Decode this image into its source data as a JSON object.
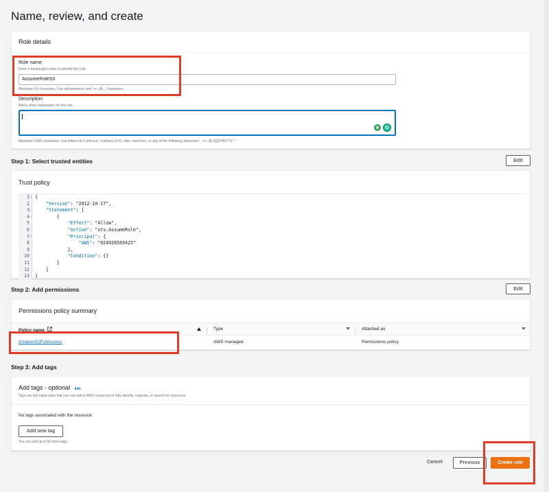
{
  "page": {
    "title": "Name, review, and create"
  },
  "role_details": {
    "heading": "Role details",
    "role_name_label": "Role name",
    "role_name_hint": "Enter a meaningful name to identify this role.",
    "role_name_value": "AssumeRoleS3",
    "role_name_constraint": "Maximum 64 characters. Use alphanumeric and '+=,.@-_' characters.",
    "description_label": "Description",
    "description_hint": "Add a short explanation for this role.",
    "description_value": "",
    "description_constraint": "Maximum 1000 characters. Use letters (A-Z and a-z), numbers (0-9), tabs, new lines, or any of the following characters: _+=,.@-/\\[{}]!#$%^*();\":'`"
  },
  "step1": {
    "title": "Step 1: Select trusted entities",
    "edit_label": "Edit",
    "trust_policy_heading": "Trust policy",
    "code_lines": [
      {
        "n": "1",
        "fold": "-",
        "text": "{"
      },
      {
        "n": "2",
        "fold": "",
        "text": "    \"Version\": \"2012-10-17\","
      },
      {
        "n": "3",
        "fold": "-",
        "text": "    \"Statement\": ["
      },
      {
        "n": "4",
        "fold": "-",
        "text": "        {"
      },
      {
        "n": "5",
        "fold": "",
        "text": "            \"Effect\": \"Allow\","
      },
      {
        "n": "6",
        "fold": "",
        "text": "            \"Action\": \"sts:AssumeRole\","
      },
      {
        "n": "7",
        "fold": "-",
        "text": "            \"Principal\": {"
      },
      {
        "n": "8",
        "fold": "",
        "text": "                \"AWS\": \"024928569425\""
      },
      {
        "n": "9",
        "fold": "",
        "text": "            },"
      },
      {
        "n": "10",
        "fold": "",
        "text": "            \"Condition\": {}"
      },
      {
        "n": "11",
        "fold": "",
        "text": "        }"
      },
      {
        "n": "12",
        "fold": "",
        "text": "    ]"
      },
      {
        "n": "13",
        "fold": "",
        "text": "}"
      }
    ]
  },
  "step2": {
    "title": "Step 2: Add permissions",
    "edit_label": "Edit",
    "summary_heading": "Permissions policy summary",
    "columns": [
      "Policy name",
      "Type",
      "Attached as"
    ],
    "rows": [
      {
        "policy_name": "AmazonS3FullAccess",
        "type": "AWS managed",
        "attached_as": "Permissions policy"
      }
    ]
  },
  "step3": {
    "title": "Step 3: Add tags",
    "heading": "Add tags - ",
    "heading_optional": "optional",
    "info_label": "Info",
    "hint": "Tags are key-value pairs that you can add to AWS resources to help identify, organize, or search for resources.",
    "empty_text": "No tags associated with the resource.",
    "add_tag_label": "Add new tag",
    "limit_text": "You can add up to 50 more tags."
  },
  "footer": {
    "cancel_label": "Cancel",
    "previous_label": "Previous",
    "create_label": "Create role"
  },
  "colors": {
    "accent": "#ec7211",
    "link": "#0073bb",
    "highlight": "#e03b24"
  }
}
